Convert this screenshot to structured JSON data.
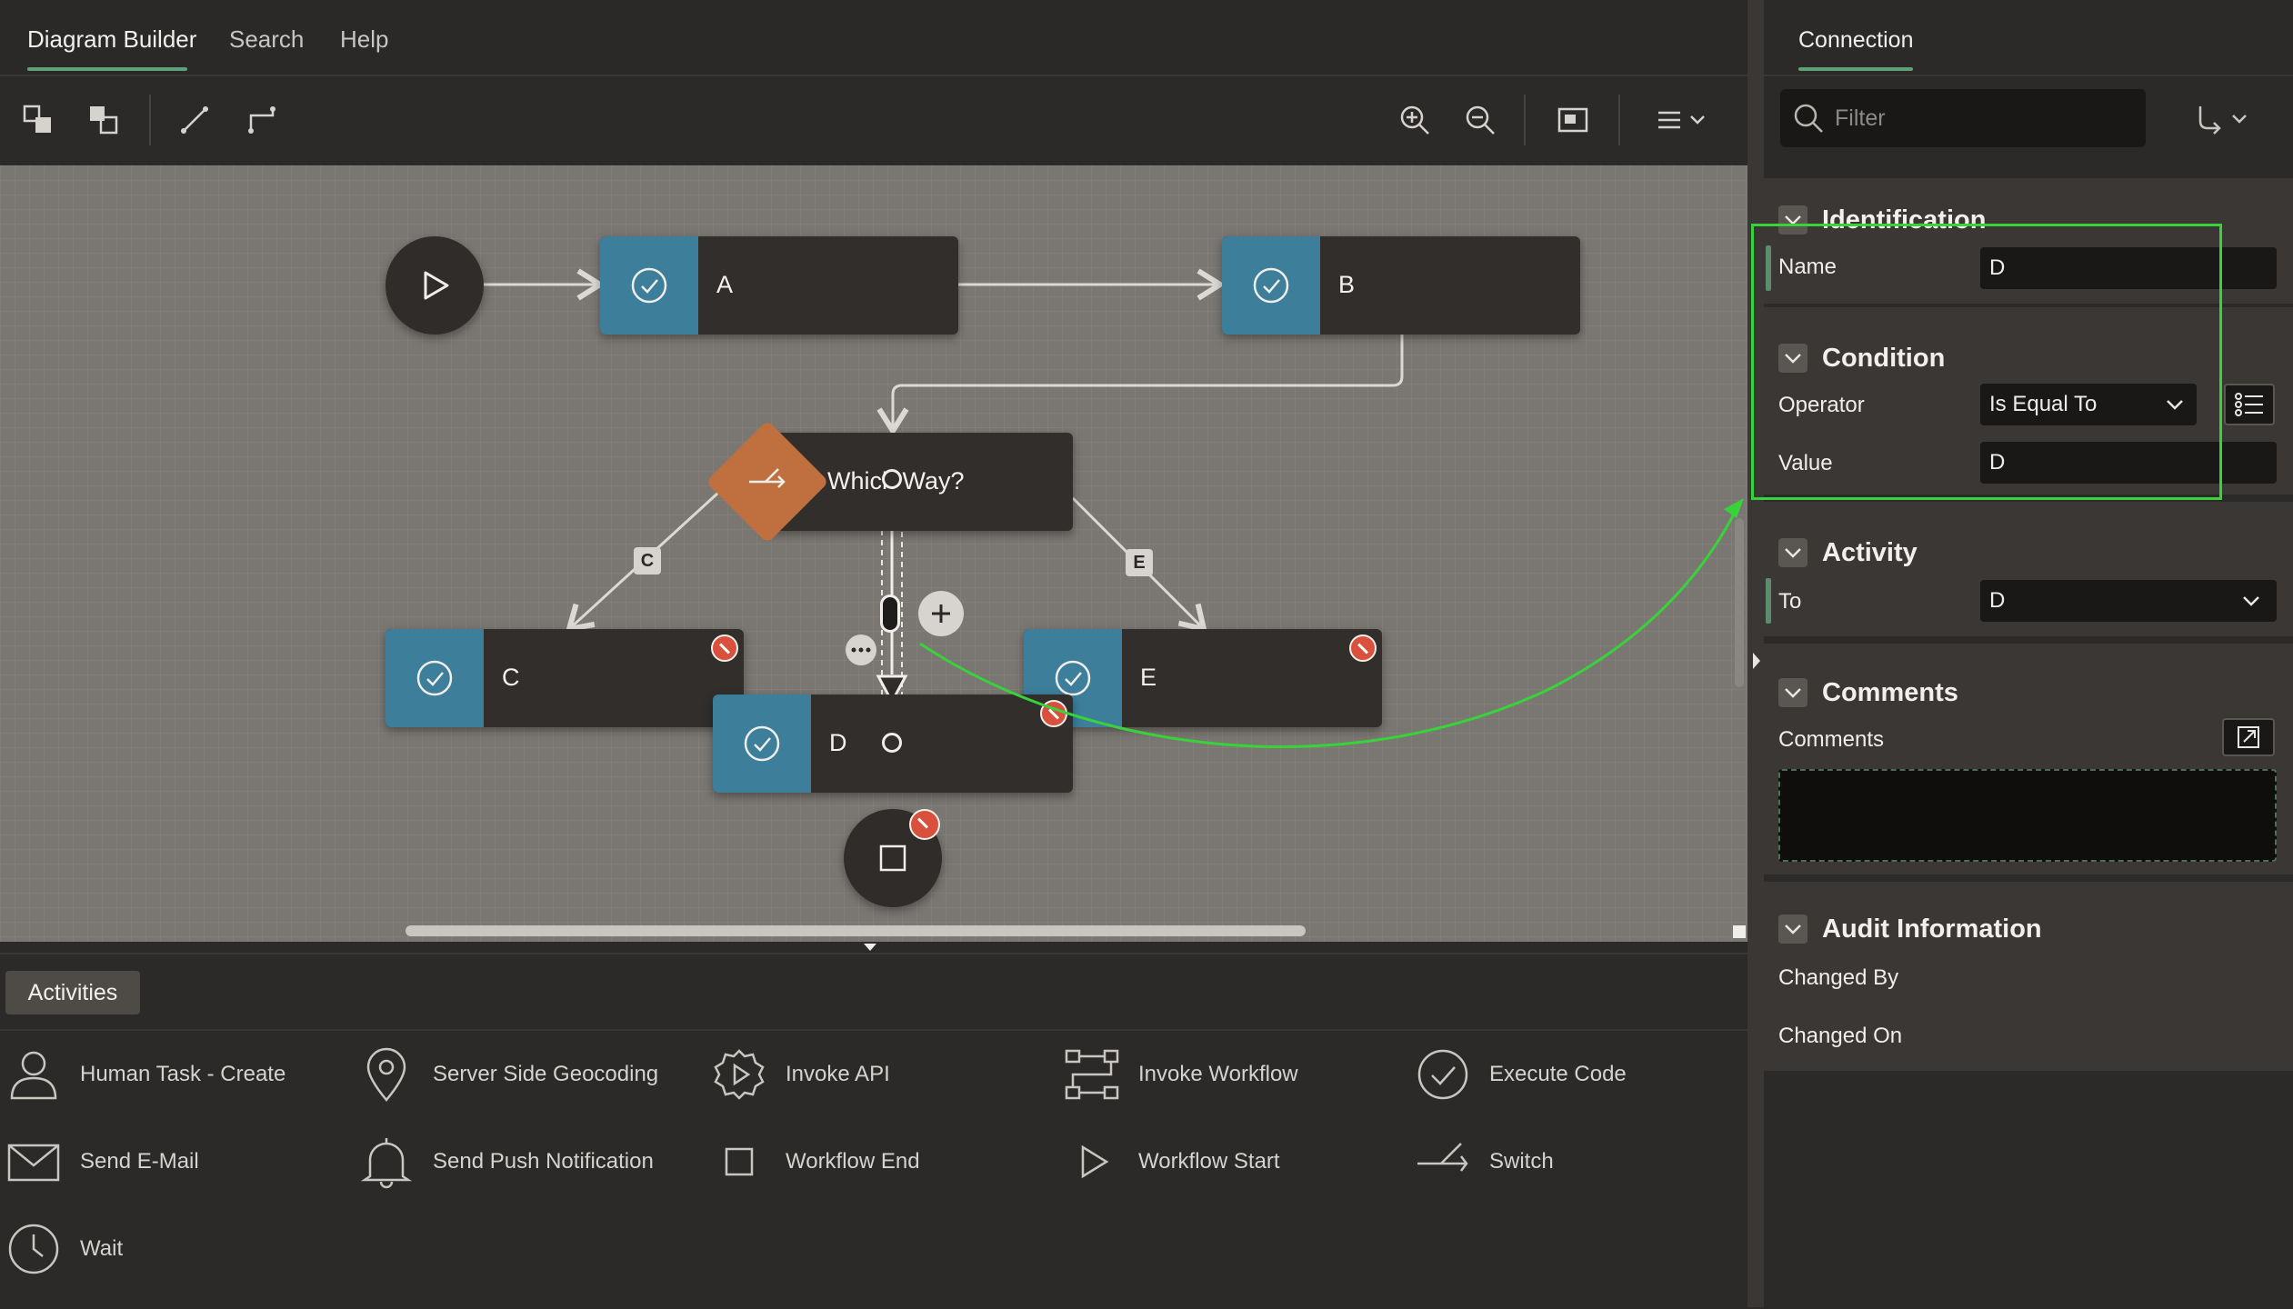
{
  "top_tabs": {
    "diagram_builder": "Diagram Builder",
    "search": "Search",
    "help": "Help"
  },
  "nodes": {
    "a": "A",
    "b": "B",
    "c": "C",
    "d": "D",
    "e": "E",
    "switch": "Which Way?"
  },
  "edge_labels": {
    "c": "C",
    "e": "E"
  },
  "activities": {
    "tab": "Activities",
    "items": [
      {
        "label": "Human Task - Create",
        "icon": "person-icon"
      },
      {
        "label": "Server Side Geocoding",
        "icon": "map-pin-icon"
      },
      {
        "label": "Invoke API",
        "icon": "gear-play-icon"
      },
      {
        "label": "Invoke Workflow",
        "icon": "workflow-icon"
      },
      {
        "label": "Execute Code",
        "icon": "check-circle-icon"
      },
      {
        "label": "Send E-Mail",
        "icon": "envelope-icon"
      },
      {
        "label": "Send Push Notification",
        "icon": "bell-icon"
      },
      {
        "label": "Workflow End",
        "icon": "square-icon"
      },
      {
        "label": "Workflow Start",
        "icon": "play-icon"
      },
      {
        "label": "Switch",
        "icon": "switch-icon"
      },
      {
        "label": "Wait",
        "icon": "clock-icon"
      }
    ]
  },
  "right_panel": {
    "tab": "Connection",
    "filter_placeholder": "Filter",
    "identification": {
      "title": "Identification",
      "name_label": "Name",
      "name_value": "D"
    },
    "condition": {
      "title": "Condition",
      "operator_label": "Operator",
      "operator_value": "Is Equal To",
      "value_label": "Value",
      "value_value": "D"
    },
    "activity": {
      "title": "Activity",
      "to_label": "To",
      "to_value": "D"
    },
    "comments": {
      "title": "Comments",
      "label": "Comments",
      "value": ""
    },
    "audit": {
      "title": "Audit Information",
      "changed_by_label": "Changed By",
      "changed_on_label": "Changed On"
    }
  },
  "colors": {
    "accent_green": "#5fa079",
    "task_tile": "#3d7e9b",
    "switch_diamond": "#c0703f",
    "error_badge": "#d9503c",
    "annotation": "#38d33a"
  }
}
